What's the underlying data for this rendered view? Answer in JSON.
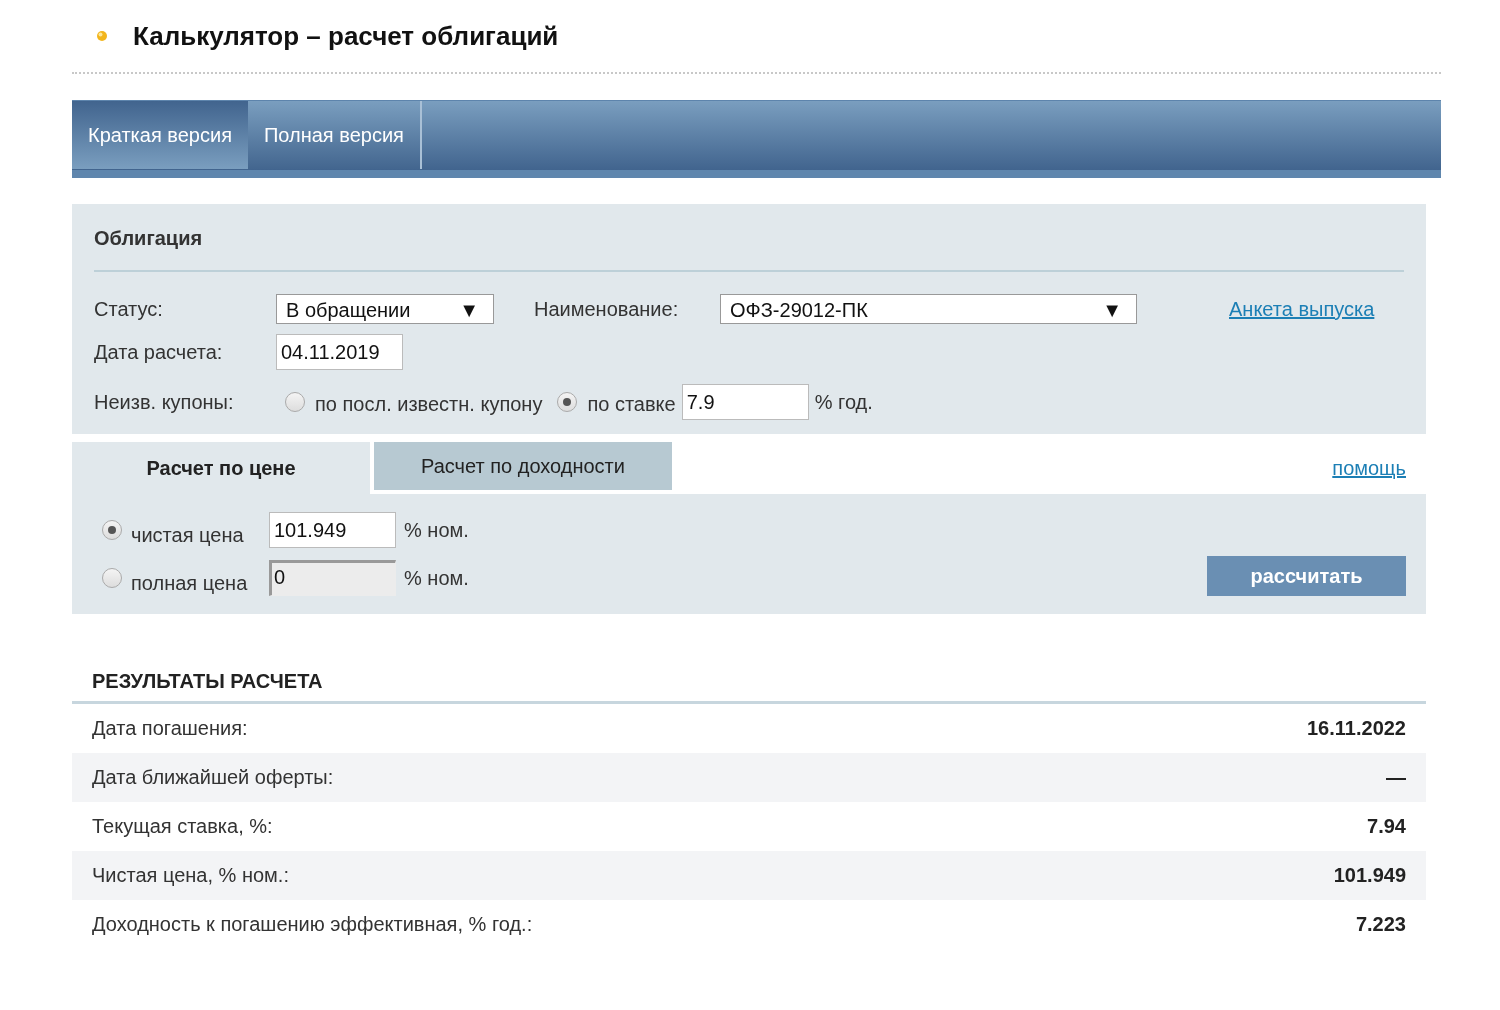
{
  "page_title": "Калькулятор – расчет облигаций",
  "version_tabs": [
    {
      "label": "Краткая версия",
      "selected": true
    },
    {
      "label": "Полная версия",
      "selected": false
    }
  ],
  "bond": {
    "heading": "Облигация",
    "status": {
      "label": "Статус:",
      "value": "В обращении",
      "caret": "▼"
    },
    "name": {
      "label": "Наименование:",
      "value": "ОФЗ-29012-ПК",
      "caret": "▼"
    },
    "issue_link": "Анкета выпуска",
    "date": {
      "label": "Дата расчета:",
      "value": "04.11.2019"
    },
    "coupons": {
      "label": "Неизв. купоны:",
      "options": [
        {
          "label": "по посл. известн. купону",
          "selected": false
        },
        {
          "label": "по ставке",
          "selected": true
        }
      ],
      "rate_value": "7.9",
      "rate_unit": "% год."
    }
  },
  "calc_tabs": [
    {
      "label": "Расчет по цене",
      "selected": true
    },
    {
      "label": "Расчет по доходности",
      "selected": false
    }
  ],
  "help_link": "помощь",
  "price_options": [
    {
      "label": "чистая цена",
      "selected": true,
      "value": "101.949",
      "unit": "% ном.",
      "disabled": false
    },
    {
      "label": "полная цена",
      "selected": false,
      "value": "0",
      "unit": "% ном.",
      "disabled": true
    }
  ],
  "calculate_button": "рассчитать",
  "results": {
    "heading": "РЕЗУЛЬТАТЫ РАСЧЕТА",
    "rows": [
      {
        "label": "Дата погашения:",
        "value": "16.11.2022"
      },
      {
        "label": "Дата ближайшей оферты:",
        "value": "—"
      },
      {
        "label": "Текущая ставка, %:",
        "value": "7.94"
      },
      {
        "label": "Чистая цена, % ном.:",
        "value": "101.949"
      },
      {
        "label": "Доходность к погашению эффективная, % год.:",
        "value": "7.223"
      }
    ]
  }
}
